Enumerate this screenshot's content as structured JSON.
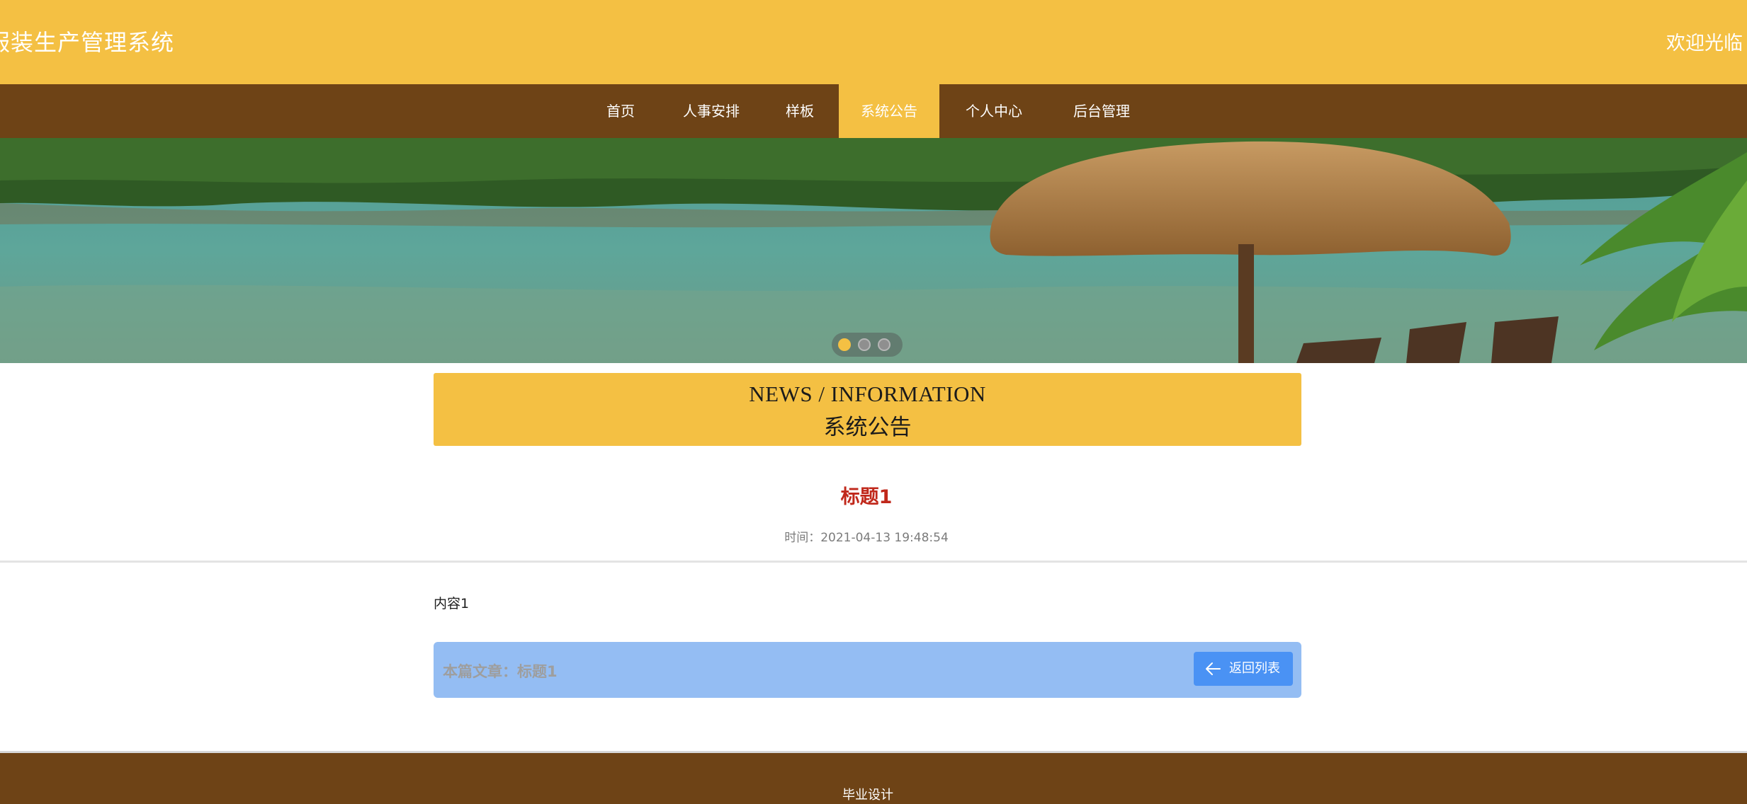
{
  "header": {
    "site_title": "服装生产管理系统",
    "welcome": "欢迎光临"
  },
  "nav": {
    "items": [
      {
        "label": "首页"
      },
      {
        "label": "人事安排"
      },
      {
        "label": "样板"
      },
      {
        "label": "系统公告",
        "active": true
      },
      {
        "label": "个人中心"
      },
      {
        "label": "后台管理"
      }
    ]
  },
  "banner": {
    "slide_count": 3,
    "active_slide": 1
  },
  "section": {
    "title_en": "NEWS / INFORMATION",
    "title_cn": "系统公告"
  },
  "article": {
    "title": "标题1",
    "time_label": "时间：",
    "time_value": "2021-04-13 19:48:54",
    "content": "内容1",
    "current_label": "本篇文章：标题1",
    "back_label": "返回列表"
  },
  "footer": {
    "text": "毕业设计"
  },
  "colors": {
    "accent_yellow": "#f4c043",
    "nav_brown": "#6e4316",
    "title_red": "#c0281b",
    "bar_blue": "#94bdf3",
    "button_blue": "#4a92f4"
  },
  "icons": {
    "back": "arrow-left-icon"
  }
}
